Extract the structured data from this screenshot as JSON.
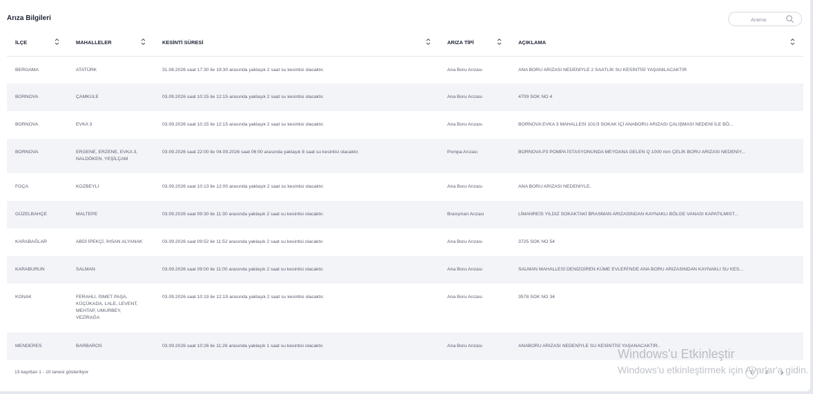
{
  "page": {
    "title": "Arıza Bilgileri"
  },
  "search": {
    "placeholder": "Arama",
    "value": ""
  },
  "table": {
    "columns": [
      {
        "label": "İLÇE"
      },
      {
        "label": "MAHALLELER"
      },
      {
        "label": "KESİNTİ SÜRESİ"
      },
      {
        "label": "ARIZA TİPİ"
      },
      {
        "label": "AÇIKLAMA"
      }
    ],
    "rows": [
      {
        "ilce": "BERGAMA",
        "mahalleler": "ATATÜRK",
        "sure": "31.08.2026 saat 17:30 ile 19:30 arasında yaklaşık 2 saat su kesintisi olacaktır.",
        "tip": "Ana Boru Arızası",
        "aciklama": "ANA BORU ARIZASI NEDENİYLE 2 SAATLİK SU KESİNTİSİ YAŞANILACAKTIR"
      },
      {
        "ilce": "BORNOVA",
        "mahalleler": "ÇAMKULE",
        "sure": "03.09.2026 saat 10:15 ile 12:15 arasında yaklaşık 2 saat su kesintisi olacaktır.",
        "tip": "Ana Boru Arızası",
        "aciklama": "4709 SOK NO 4"
      },
      {
        "ilce": "BORNOVA",
        "mahalleler": "EVKA 3",
        "sure": "03.09.2026 saat 10:15 ile 12:15 arasında yaklaşık 2 saat su kesintisi olacaktır.",
        "tip": "Ana Boru Arızası",
        "aciklama": "BORNOVA EVKA 3 MAHALLESİ 101/3 SOKAK İÇİ ANABORU ARIZASI ÇALIŞMASI NEDENİ İLE BÖ..."
      },
      {
        "ilce": "BORNOVA",
        "mahalleler": "ERGENE, ERZENE, EVKA 3, NALDÖKEN, YEŞİLÇAM",
        "sure": "03.09.2026 saat 22:00 ile 04.09.2026 saat 06:00 arasında yaklaşık 8 saat su kesintisi olacaktır.",
        "tip": "Pompa Arızası",
        "aciklama": "BORNOVA P3 POMPA İSTASYONUNDA MEYDANA GELEN Q 1000 mm ÇELİK BORU ARIZASI NEDENİY..."
      },
      {
        "ilce": "FOÇA",
        "mahalleler": "KOZBEYLİ",
        "sure": "03.09.2026 saat 10:13 ile 12:00 arasında yaklaşık 2 saat su kesintisi olacaktır.",
        "tip": "Ana Boru Arızası",
        "aciklama": "ANA BORU ARIZASI NEDENİYLE."
      },
      {
        "ilce": "GÜZELBAHÇE",
        "mahalleler": "MALTEPE",
        "sure": "03.09.2026 saat 09:30 ile 11:30 arasında yaklaşık 2 saat su kesintisi olacaktır.",
        "tip": "Branşman Arızası",
        "aciklama": "LİMANREİS YILDIZ SOKAKTAKİ BRASMAN ARIZASINDAN KAYNAKLI BÖLGE VANASI KAPATILMIST..."
      },
      {
        "ilce": "KARABAĞLAR",
        "mahalleler": "ABDİ İPEKÇİ, İHSAN ALYANAK",
        "sure": "03.09.2026 saat 09:52 ile 11:52 arasında yaklaşık 2 saat su kesintisi olacaktır.",
        "tip": "Ana Boru Arızası",
        "aciklama": "3725 SOK NO 54"
      },
      {
        "ilce": "KARABURUN",
        "mahalleler": "SALMAN",
        "sure": "03.09.2026 saat 09:00 ile 11:00 arasında yaklaşık 2 saat su kesintisi olacaktır.",
        "tip": "Ana Boru Arızası",
        "aciklama": "SALMAN MAHALLESİ DENİZGİREN KÜME EVLERİ'NDE ANA BORU ARIZASINDAN KAYNAKLI SU KES..."
      },
      {
        "ilce": "KONAK",
        "mahalleler": "FERAHLI, İSMET PAŞA, KÜÇÜKADA, LALE, LEVENT, MEHTAP, UMURBEY, VEZİRAĞA",
        "sure": "03.09.2026 saat 10:19 ile 12:19 arasında yaklaşık 2 saat su kesintisi olacaktır.",
        "tip": "Ana Boru Arızası",
        "aciklama": "3578 SOK NO 34"
      },
      {
        "ilce": "MENDERES",
        "mahalleler": "BARBAROS",
        "sure": "03.09.2026 saat 10:26 ile 11:26 arasında yaklaşık 1 saat su kesintisi olacaktır.",
        "tip": "Ana Boru Arızası",
        "aciklama": "ANABORU ARIZASI NEDENİYLE SU KESİNTİSİ YAŞANACAKTIR.."
      }
    ]
  },
  "footer": {
    "info": "13 kayıttan 1 - 10 tanesi gösteriliyor"
  },
  "pagination": {
    "pages": [
      "1",
      "2"
    ]
  },
  "watermark": {
    "title": "Windows'u Etkinleştir",
    "subtitle": "Windows'u etkinleştirmek için Ayarlar'a gidin."
  }
}
